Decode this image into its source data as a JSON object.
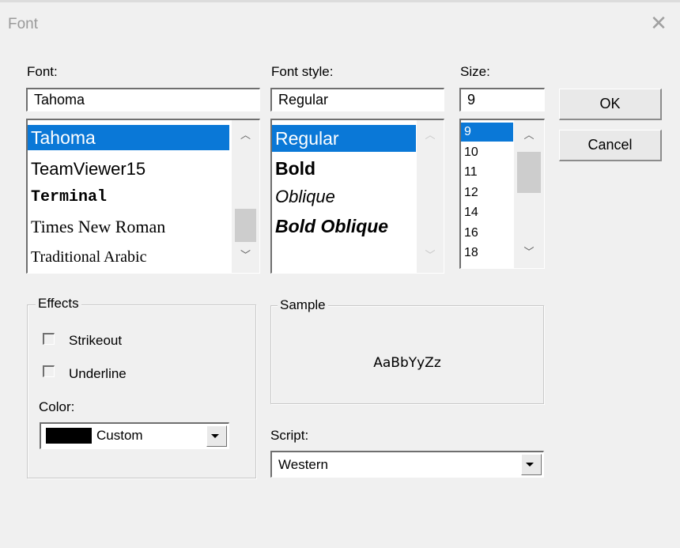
{
  "dialog": {
    "title": "Font",
    "close_glyph": "✕"
  },
  "font": {
    "label": "Font:",
    "value": "Tahoma",
    "options": [
      {
        "label": "Tahoma",
        "selected": true
      },
      {
        "label": "TeamViewer15",
        "selected": false
      },
      {
        "label": "Terminal",
        "selected": false
      },
      {
        "label": "Times New Roman",
        "selected": false
      },
      {
        "label": "Traditional Arabic",
        "selected": false
      }
    ]
  },
  "font_style": {
    "label": "Font style:",
    "value": "Regular",
    "options": [
      {
        "label": "Regular",
        "selected": true
      },
      {
        "label": "Bold",
        "selected": false
      },
      {
        "label": "Oblique",
        "selected": false
      },
      {
        "label": "Bold Oblique",
        "selected": false
      }
    ]
  },
  "size": {
    "label": "Size:",
    "value": "9",
    "options": [
      "9",
      "10",
      "11",
      "12",
      "14",
      "16",
      "18"
    ],
    "selected": "9"
  },
  "buttons": {
    "ok": "OK",
    "cancel": "Cancel"
  },
  "effects": {
    "legend": "Effects",
    "strikeout_label": "Strikeout",
    "strikeout_checked": false,
    "underline_label": "Underline",
    "underline_checked": false,
    "color_label": "Color:",
    "color_value": "Custom",
    "color_swatch": "#000000"
  },
  "sample": {
    "legend": "Sample",
    "text": "AaBbYyZz"
  },
  "script": {
    "label": "Script:",
    "value": "Western"
  },
  "icons": {
    "up": "chevron-up-icon",
    "down": "chevron-down-icon",
    "dropdown": "dropdown-arrow-icon"
  },
  "colors": {
    "selection": "#0a78d7",
    "background": "#f0f0f0"
  }
}
